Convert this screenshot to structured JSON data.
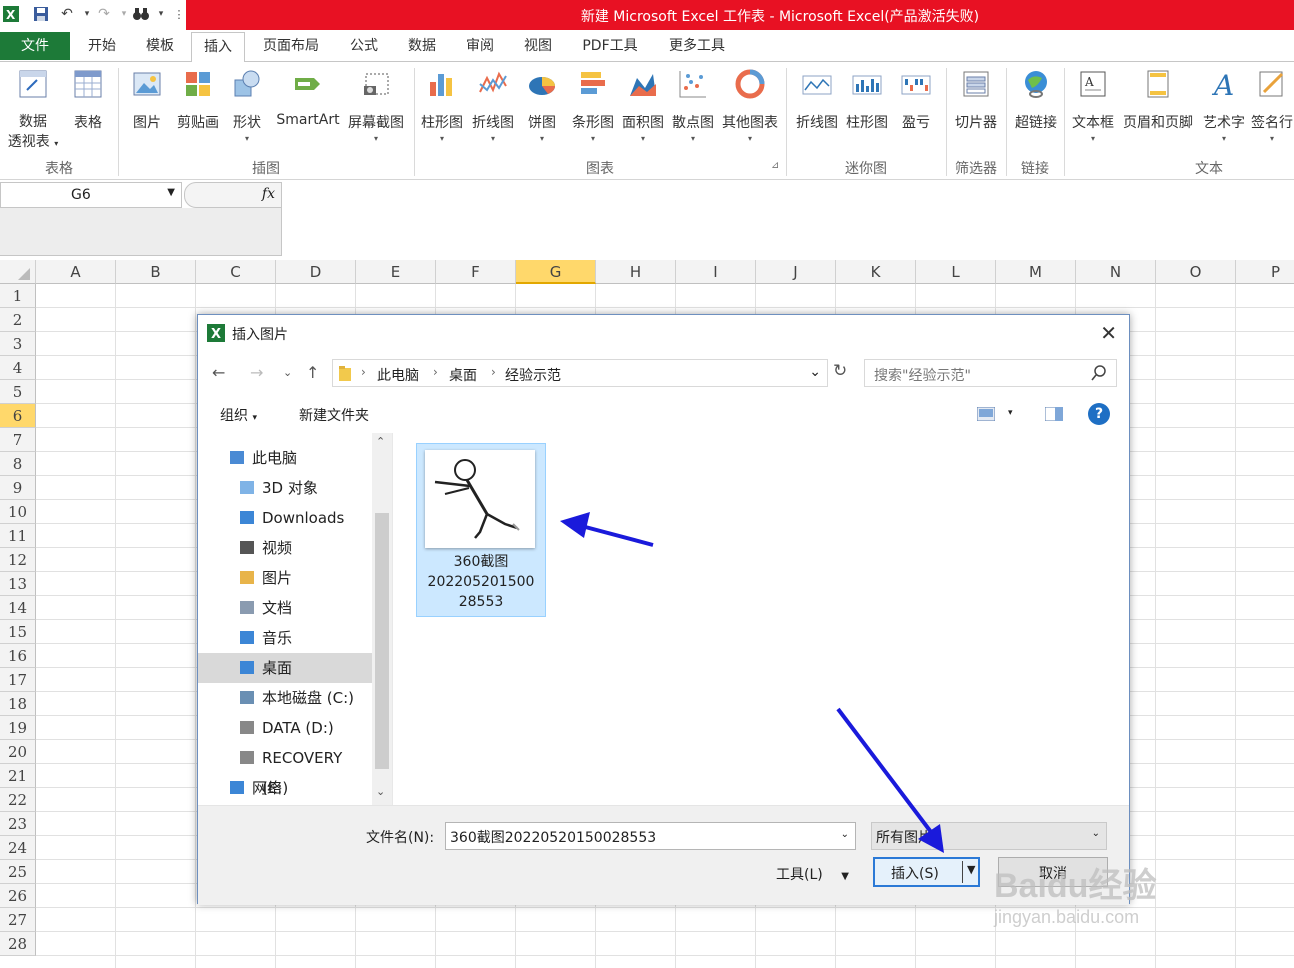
{
  "app": {
    "title": "新建 Microsoft Excel 工作表 - Microsoft Excel(产品激活失败)",
    "brand_color": "#1d7a38",
    "titlebar_color": "#e81123"
  },
  "quick_access": [
    {
      "icon": "excel-icon"
    },
    {
      "icon": "save-icon"
    },
    {
      "icon": "undo-icon"
    },
    {
      "icon": "redo-icon"
    },
    {
      "icon": "binoculars-icon"
    },
    {
      "icon": "customize-icon"
    }
  ],
  "tabs": [
    "文件",
    "开始",
    "模板",
    "插入",
    "页面布局",
    "公式",
    "数据",
    "审阅",
    "视图",
    "PDF工具",
    "更多工具"
  ],
  "active_tab": "插入",
  "ribbon": {
    "buttons": [
      {
        "label": "数据",
        "label2": "透视表",
        "icon": "pivot-table-icon"
      },
      {
        "label": "表格",
        "icon": "table-icon"
      },
      {
        "label": "图片",
        "icon": "picture-icon"
      },
      {
        "label": "剪贴画",
        "icon": "clip-art-icon"
      },
      {
        "label": "形状",
        "icon": "shapes-icon"
      },
      {
        "label": "SmartArt",
        "icon": "smartart-icon"
      },
      {
        "label": "屏幕截图",
        "icon": "screenshot-icon"
      },
      {
        "label": "柱形图",
        "icon": "column-chart-icon"
      },
      {
        "label": "折线图",
        "icon": "line-chart-icon"
      },
      {
        "label": "饼图",
        "icon": "pie-chart-icon"
      },
      {
        "label": "条形图",
        "icon": "bar-chart-icon"
      },
      {
        "label": "面积图",
        "icon": "area-chart-icon"
      },
      {
        "label": "散点图",
        "icon": "scatter-chart-icon"
      },
      {
        "label": "其他图表",
        "icon": "other-charts-icon"
      },
      {
        "label": "折线图",
        "icon": "sparkline-line-icon"
      },
      {
        "label": "柱形图",
        "icon": "sparkline-column-icon"
      },
      {
        "label": "盈亏",
        "icon": "win-loss-icon"
      },
      {
        "label": "切片器",
        "icon": "slicer-icon"
      },
      {
        "label": "超链接",
        "icon": "hyperlink-icon"
      },
      {
        "label": "文本框",
        "icon": "text-box-icon"
      },
      {
        "label": "页眉和页脚",
        "icon": "header-footer-icon"
      },
      {
        "label": "艺术字",
        "icon": "wordart-icon"
      },
      {
        "label": "签名行",
        "icon": "signature-line-icon"
      }
    ],
    "groups": [
      "表格",
      "插图",
      "图表",
      "迷你图",
      "筛选器",
      "链接",
      "文本"
    ]
  },
  "formula_bar": {
    "name_box": "G6",
    "fx_label": "fx",
    "formula": ""
  },
  "sheet": {
    "columns": [
      "A",
      "B",
      "C",
      "D",
      "E",
      "F",
      "G",
      "H",
      "I",
      "J",
      "K",
      "L",
      "M",
      "N",
      "O",
      "P"
    ],
    "rows": [
      "1",
      "2",
      "3",
      "4",
      "5",
      "6",
      "7",
      "8",
      "9",
      "10",
      "11",
      "12",
      "13",
      "14",
      "15",
      "16",
      "17",
      "18",
      "19",
      "20",
      "21",
      "22",
      "23",
      "24",
      "25",
      "26",
      "27",
      "28"
    ],
    "selected_column": "G",
    "selected_row": "6"
  },
  "dialog": {
    "title": "插入图片",
    "breadcrumb": [
      "此电脑",
      "桌面",
      "经验示范"
    ],
    "search_placeholder": "搜索\"经验示范\"",
    "organize": "组织",
    "new_folder": "新建文件夹",
    "help": "?",
    "nav_items": [
      {
        "label": "此电脑",
        "icon": "computer-icon",
        "indent": 1
      },
      {
        "label": "3D 对象",
        "icon": "folder-3d-icon",
        "indent": 2
      },
      {
        "label": "Downloads",
        "icon": "downloads-folder-icon",
        "indent": 2
      },
      {
        "label": "视频",
        "icon": "video-folder-icon",
        "indent": 2
      },
      {
        "label": "图片",
        "icon": "pictures-folder-icon",
        "indent": 2
      },
      {
        "label": "文档",
        "icon": "documents-folder-icon",
        "indent": 2
      },
      {
        "label": "音乐",
        "icon": "music-folder-icon",
        "indent": 2
      },
      {
        "label": "桌面",
        "icon": "desktop-folder-icon",
        "indent": 2,
        "selected": true
      },
      {
        "label": "本地磁盘 (C:)",
        "icon": "local-disk-icon",
        "indent": 2
      },
      {
        "label": "DATA (D:)",
        "icon": "drive-icon",
        "indent": 2
      },
      {
        "label": "RECOVERY (E:)",
        "icon": "drive-icon",
        "indent": 2
      },
      {
        "label": "网络",
        "icon": "network-icon",
        "indent": 1
      }
    ],
    "file": {
      "name_lines": [
        "360截图",
        "202205201500",
        "28553"
      ],
      "thumbnail": "stick-figure-thumbnail"
    },
    "filename_label": "文件名(N):",
    "filename_value": "360截图20220520150028553",
    "filetype_value": "所有图片",
    "tools_label": "工具(L)",
    "insert_label": "插入(S)",
    "cancel_label": "取消"
  },
  "annotations": {
    "arrow_color": "#1a1adb"
  },
  "watermark": {
    "brand": "Baidu经验",
    "url": "jingyan.baidu.com"
  }
}
